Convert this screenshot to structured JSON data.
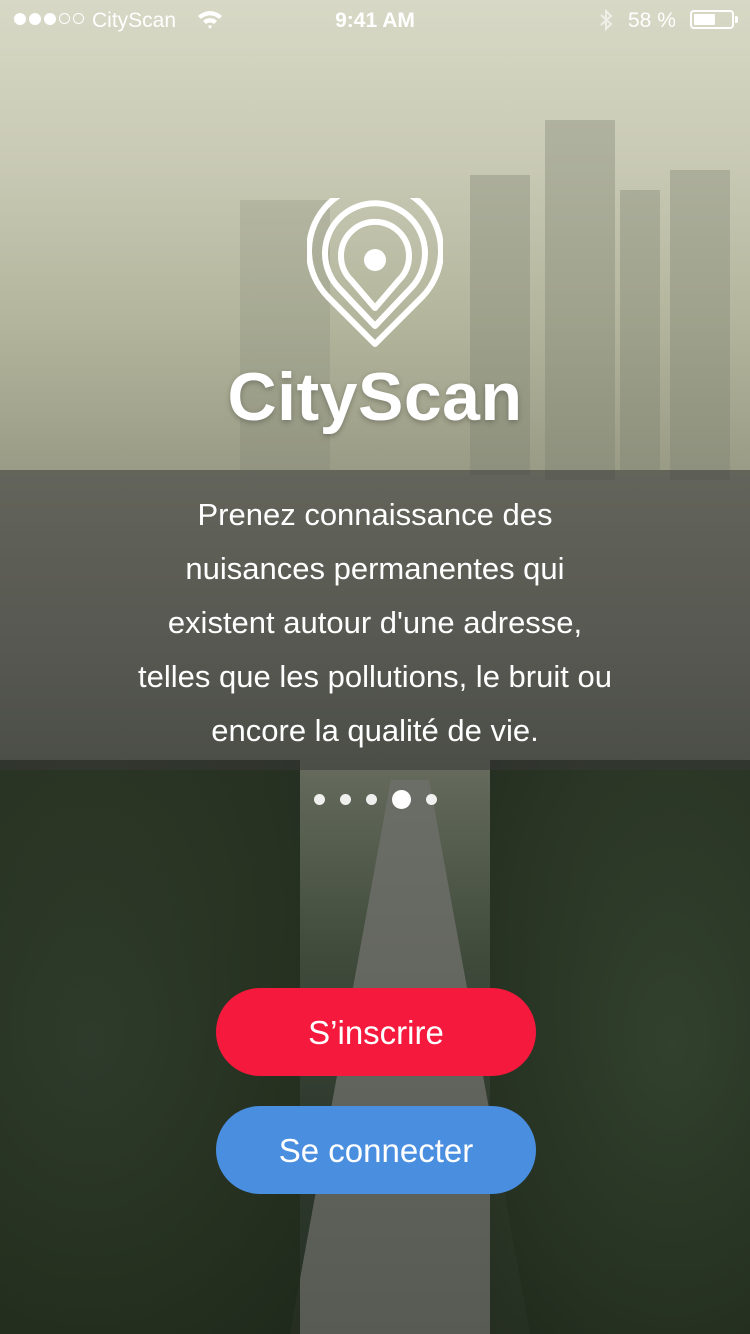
{
  "status_bar": {
    "carrier": "CityScan",
    "time": "9:41 AM",
    "battery_percent": "58 %",
    "battery_level": 0.58,
    "signal_bars_filled": 3,
    "signal_bars_total": 5,
    "icons": [
      "signal-dots",
      "wifi-icon",
      "bluetooth-icon",
      "battery-icon"
    ]
  },
  "brand": {
    "name": "CityScan",
    "logo_icon": "location-pin-icon"
  },
  "intro": {
    "lines": [
      "Prenez connaissance des",
      "nuisances permanentes qui",
      "existent autour d'une adresse,",
      "telles que les pollutions, le bruit ou",
      "encore la qualité de vie."
    ]
  },
  "pager": {
    "total": 5,
    "active_index": 3
  },
  "actions": {
    "signup_label": "S’inscrire",
    "login_label": "Se connecter"
  },
  "colors": {
    "signup": "#f5193d",
    "login": "#4a8ee0",
    "band": "rgba(55,55,55,0.55)"
  }
}
